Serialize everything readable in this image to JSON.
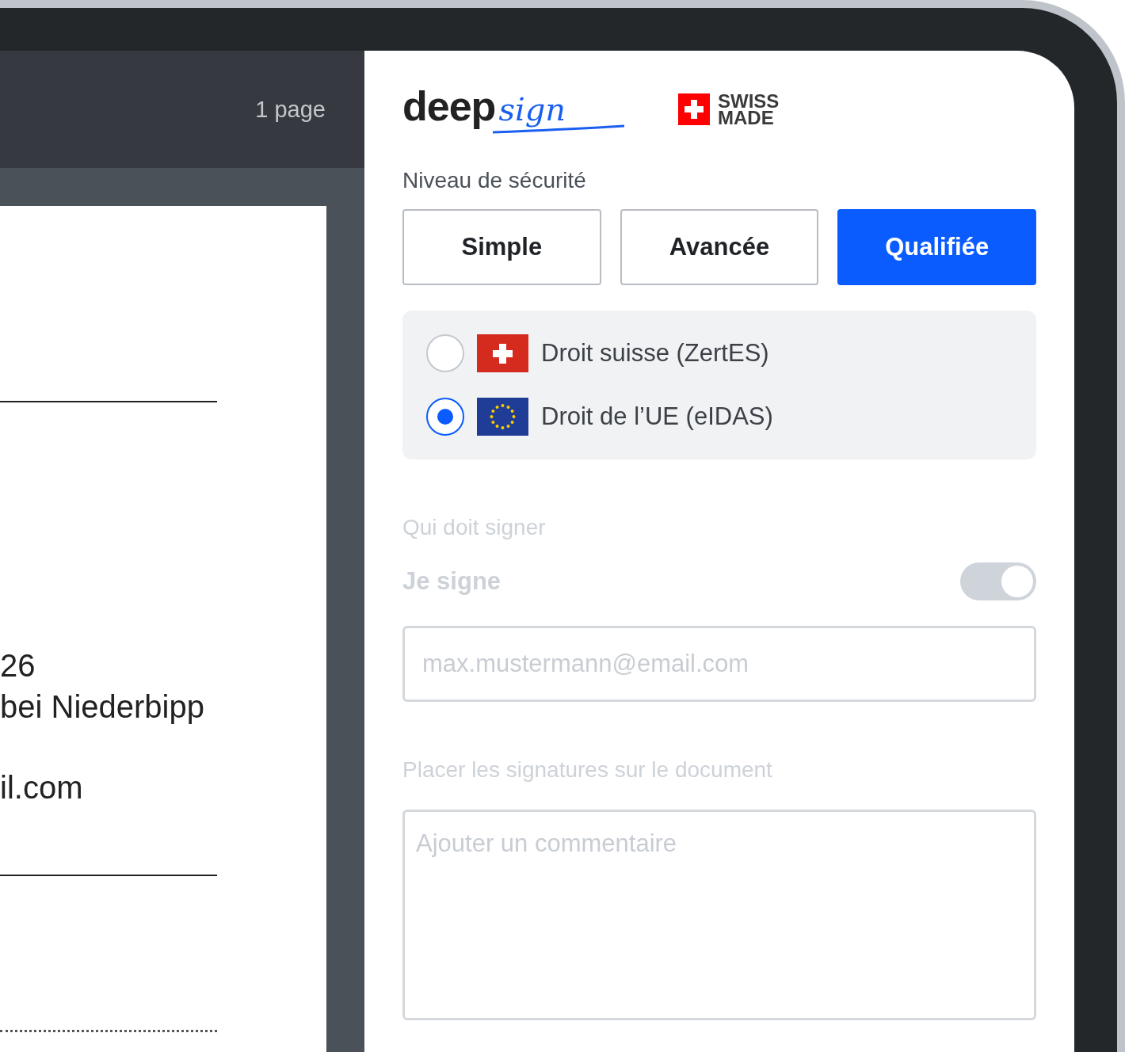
{
  "document_viewer": {
    "page_count": "1 page",
    "text_lines": [
      "26",
      "bei Niederbipp",
      "il.com"
    ]
  },
  "logo": {
    "word": "deep",
    "script": "sign"
  },
  "badge": {
    "lines": [
      "SWISS",
      "MADE"
    ]
  },
  "security": {
    "label": "Niveau de sécurité",
    "levels": [
      {
        "label": "Simple",
        "selected": false
      },
      {
        "label": "Avancée",
        "selected": false
      },
      {
        "label": "Qualifiée",
        "selected": true
      }
    ],
    "jurisdictions": [
      {
        "kind": "ch",
        "label": "Droit suisse (ZertES)",
        "selected": false
      },
      {
        "kind": "eu",
        "label": "Droit de l’UE (eIDAS)",
        "selected": true
      }
    ]
  },
  "signers": {
    "disabled": true,
    "label": "Qui doit signer",
    "self_sign": {
      "label": "Je signe",
      "on": true
    },
    "email": {
      "placeholder": "max.mustermann@email.com"
    }
  },
  "placement": {
    "disabled": true,
    "label": "Placer les signatures sur le document",
    "comment": {
      "placeholder": "Ajouter un commentaire"
    }
  }
}
